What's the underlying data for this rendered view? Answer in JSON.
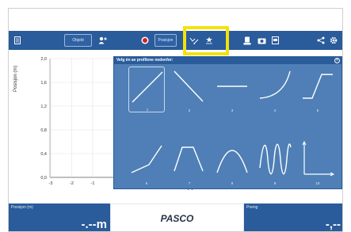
{
  "toolbar": {
    "object_label": "Objekt",
    "position_label": "Posisjon"
  },
  "chart_data": {
    "type": "line",
    "ylabel": "Posisjon (m)",
    "xlabel": "Tid (s)",
    "ytick_labels": [
      "2,0",
      "1,6",
      "1,2",
      "0,8",
      "0,4",
      "0,0"
    ],
    "xtick_labels": [
      "-3",
      "-2",
      "-1"
    ],
    "series": []
  },
  "overlay": {
    "title": "Velg én av profilene nedenfor:",
    "close_symbol": "✕",
    "profiles": [
      "1",
      "2",
      "3",
      "4",
      "5",
      "6",
      "7",
      "8",
      "9",
      "10"
    ]
  },
  "panels": {
    "left_label": "Posisjon (m)",
    "left_value": "-.--m",
    "brand": "PASCO",
    "right_label": "Poeng",
    "right_value": "-,--"
  },
  "colors": {
    "primary": "#2a5b9a",
    "overlay": "#4f7fb6",
    "highlight": "#f2e20c"
  }
}
